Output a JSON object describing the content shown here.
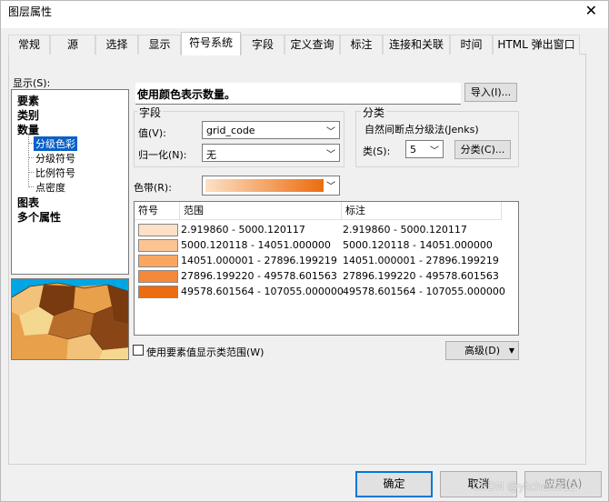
{
  "window": {
    "title": "图层属性",
    "close_glyph": "✕"
  },
  "tabs": [
    {
      "label": "常规",
      "active": false
    },
    {
      "label": "源",
      "active": false
    },
    {
      "label": "选择",
      "active": false
    },
    {
      "label": "显示",
      "active": false
    },
    {
      "label": "符号系统",
      "active": true
    },
    {
      "label": "字段",
      "active": false
    },
    {
      "label": "定义查询",
      "active": false
    },
    {
      "label": "标注",
      "active": false
    },
    {
      "label": "连接和关联",
      "active": false
    },
    {
      "label": "时间",
      "active": false
    },
    {
      "label": "HTML 弹出窗口",
      "active": false
    }
  ],
  "show_label": "显示(S):",
  "tree": {
    "items": [
      "要素",
      "类别",
      "数量",
      "分级色彩",
      "分级符号",
      "比例符号",
      "点密度",
      "图表",
      "多个属性"
    ]
  },
  "description": "使用颜色表示数量。",
  "import_button": "导入(I)...",
  "fields_group": {
    "title": "字段",
    "value_label": "值(V):",
    "value": "grid_code",
    "normalize_label": "归一化(N):",
    "normalize": "无"
  },
  "classify_group": {
    "title": "分类",
    "method": "自然间断点分级法(Jenks)",
    "classes_label": "类(S):",
    "classes": "5",
    "classify_button": "分类(C)..."
  },
  "color_ramp_label": "色带(R):",
  "table": {
    "headers": [
      "符号",
      "范围",
      "标注"
    ],
    "rows": [
      {
        "color": "#fde0c5",
        "range": "2.919860 - 5000.120117",
        "label": "2.919860 - 5000.120117"
      },
      {
        "color": "#fcc493",
        "range": "5000.120118 - 14051.000000",
        "label": "5000.120118 - 14051.000000"
      },
      {
        "color": "#f9a661",
        "range": "14051.000001 - 27896.199219",
        "label": "14051.000001 - 27896.199219"
      },
      {
        "color": "#f5883a",
        "range": "27896.199220 - 49578.601563",
        "label": "27896.199220 - 49578.601563"
      },
      {
        "color": "#ec6c0f",
        "range": "49578.601564 - 107055.000000",
        "label": "49578.601564 - 107055.000000"
      }
    ]
  },
  "checkbox_label": "使用要素值显示类范围(W)",
  "advanced_button": "高级(D)",
  "ok_button": "确定",
  "cancel_button": "取消",
  "apply_button": "应用(A)",
  "watermark": "CSDN @ytchen312"
}
